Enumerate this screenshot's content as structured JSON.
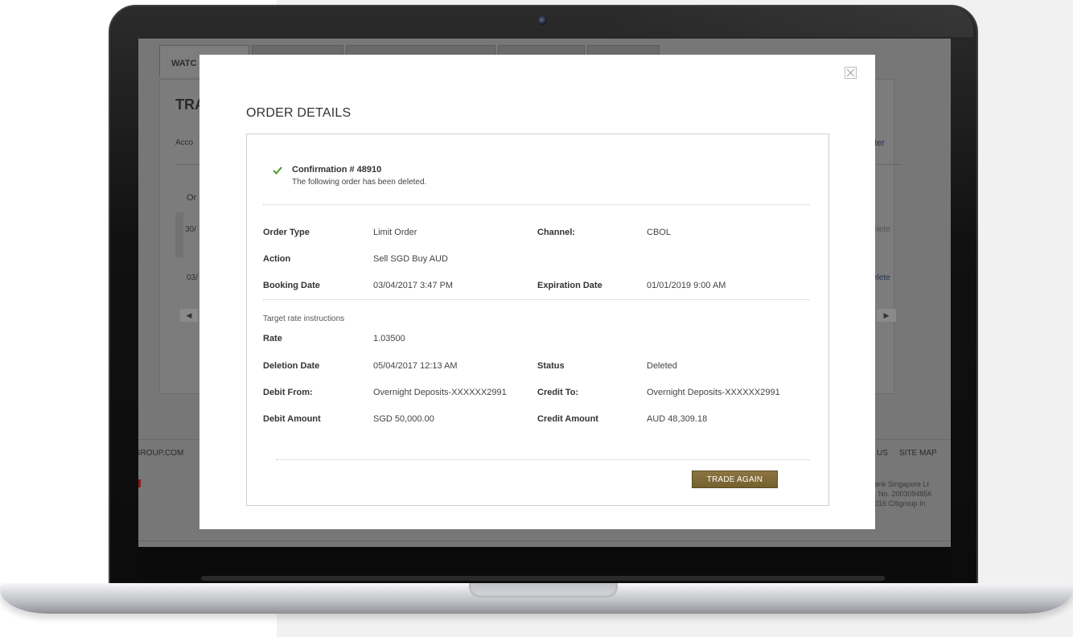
{
  "background_page": {
    "tabs": [
      "WATC",
      "",
      "",
      "",
      ""
    ],
    "title": "TRA",
    "account_label": "Acco",
    "column_header": "Or",
    "row_1_date": "30/",
    "row_2_date": "03/",
    "scroll_left_icon": "◀",
    "scroll_right_icon": "▶",
    "right_header": "ter",
    "row_1_action": "elete",
    "row_2_action": "elete",
    "footer_left": "IGROUP.COM",
    "footer_right": [
      "US",
      "SITE MAP"
    ],
    "copyright_lines": [
      "bank Singapore Lt",
      "g. No. 2003094856",
      "2016 Citigroup In"
    ]
  },
  "modal": {
    "title": "ORDER DETAILS",
    "close_icon": "close-icon",
    "confirmation": {
      "title": "Confirmation # 48910",
      "message": "The following order has been deleted.",
      "icon": "checkmark-icon",
      "icon_color": "#4a9a2c"
    },
    "details": {
      "order_type_label": "Order Type",
      "order_type_value": "Limit Order",
      "channel_label": "Channel:",
      "channel_value": "CBOL",
      "action_label": "Action",
      "action_value": "Sell SGD Buy AUD",
      "booking_date_label": "Booking Date",
      "booking_date_value": "03/04/2017 3:47 PM",
      "expiration_date_label": "Expiration Date",
      "expiration_date_value": "01/01/2019 9:00 AM"
    },
    "target_rate": {
      "section_label": "Target rate instructions",
      "rate_label": "Rate",
      "rate_value": "1.03500",
      "deletion_date_label": "Deletion Date",
      "deletion_date_value": "05/04/2017 12:13 AM",
      "status_label": "Status",
      "status_value": "Deleted",
      "debit_from_label": "Debit From:",
      "debit_from_value": "Overnight Deposits-XXXXXX2991",
      "credit_to_label": "Credit To:",
      "credit_to_value": "Overnight Deposits-XXXXXX2991",
      "debit_amount_label": "Debit Amount",
      "debit_amount_value": "SGD 50,000.00",
      "credit_amount_label": "Credit Amount",
      "credit_amount_value": "AUD 48,309.18"
    },
    "trade_again_label": "TRADE AGAIN",
    "button_color": "#7f6a38"
  }
}
